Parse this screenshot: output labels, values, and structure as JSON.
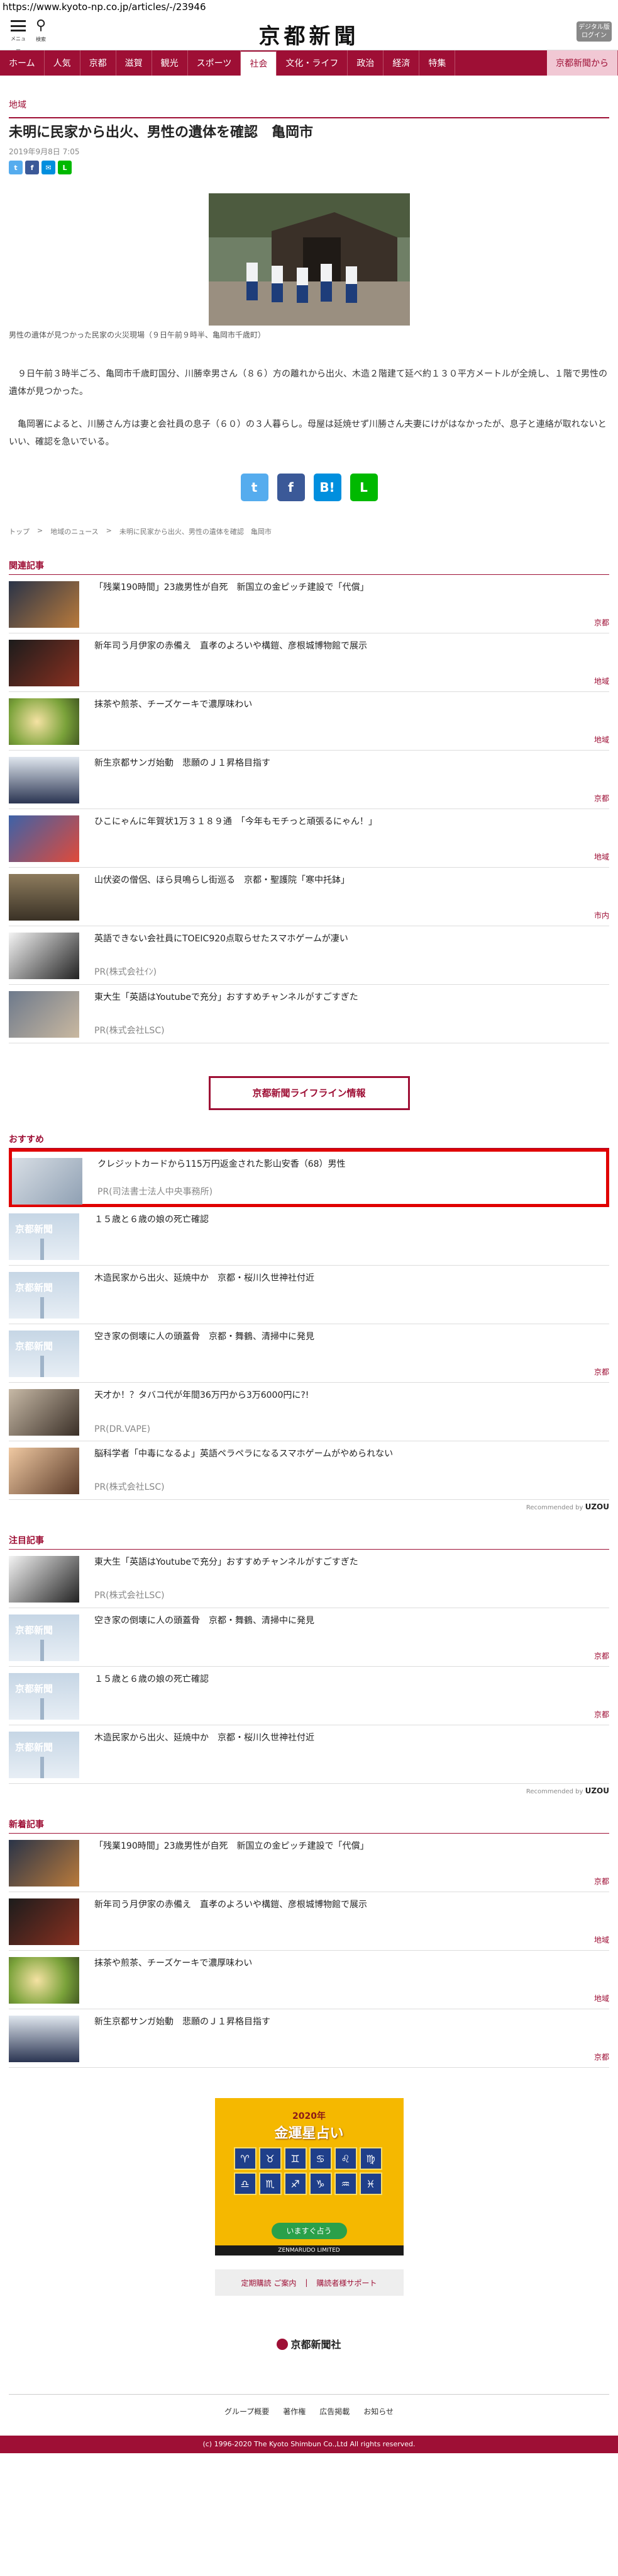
{
  "browser": {
    "url": "https://www.kyoto-np.co.jp/articles/-/23946"
  },
  "header": {
    "logo": "京都新聞",
    "menu_label": "メニュー",
    "search_label": "検索",
    "digital_label_1": "デジタル版",
    "digital_label_2": "ログイン"
  },
  "nav": [
    "ホーム",
    "人気",
    "京都",
    "滋賀",
    "観光",
    "スポーツ",
    "社会",
    "文化・ライフ",
    "政治",
    "経済",
    "特集",
    "京都新聞から"
  ],
  "article": {
    "category": "地域",
    "title": "未明に民家から出火、男性の遺体を確認　亀岡市",
    "date": "2019年9月8日 7:05",
    "caption": "男性の遺体が見つかった民家の火災現場（９日午前９時半、亀岡市千歳町）",
    "paragraphs": [
      "９日午前３時半ごろ、亀岡市千歳町国分、川勝幸男さん（８６）方の離れから出火、木造２階建て延べ約１３０平方メートルが全焼し、１階で男性の遺体が見つかった。",
      "亀岡署によると、川勝さん方は妻と会社員の息子（６０）の３人暮らし。母屋は延焼せず川勝さん夫妻にけがはなかったが、息子と連絡が取れないといい、確認を急いでいる。"
    ]
  },
  "share_icons": {
    "twitter": "twitter-icon",
    "facebook": "facebook-icon",
    "hatena": "hatena-icon",
    "line": "line-icon"
  },
  "breadcrumb": [
    "トップ",
    "地域のニュース",
    "未明に民家から出火、男性の遺体を確認　亀岡市"
  ],
  "related": {
    "heading": "関連記事",
    "items": [
      {
        "title": "「残業190時間」23歳男性が自死　新国立の金ピッチ建設で「代償」",
        "tag": "京都"
      },
      {
        "title": "新年司う月伊家の赤備え　直孝のよろいや構鎧、彦根城博物館で展示",
        "tag": "地域"
      },
      {
        "title": "抹茶や煎茶、チーズケーキで濃厚味わい",
        "tag": "地域"
      },
      {
        "title": "新生京都サンガ始動　悲願のＪ１昇格目指す",
        "tag": "京都"
      },
      {
        "title": "ひこにゃんに年賀状1万３１８９通　「今年もモチっと頑張るにゃん！」",
        "tag": "地域"
      },
      {
        "title": "山伏姿の僧侶、ほら貝鳴らし街巡る　京都・聖護院「寒中托鉢」",
        "tag": "市内"
      }
    ],
    "pr_items": [
      {
        "title": "英語できない会社員にTOEIC920点取らせたスマホゲームが凄い",
        "pr": "PR(株式会社ｲﾝ)"
      },
      {
        "title": "東大生「英語はYoutubeで充分」おすすめチャンネルがすごすぎた",
        "pr": "PR(株式会社LSC)"
      }
    ]
  },
  "lifeline": {
    "label": "京都新聞ライフライン情報"
  },
  "recommend": {
    "heading": "おすすめ",
    "highlight": {
      "title": "クレジットカードから115万円返金された影山安香（68）男性",
      "pr": "PR(司法書士法人中央事務所)"
    },
    "items": [
      {
        "title": "１５歳と６歳の娘の死亡確認",
        "tag": ""
      },
      {
        "title": "木造民家から出火、延焼中か　京都・桜川久世神社付近",
        "tag": ""
      },
      {
        "title": "空き家の倒壊に人の頭蓋骨　京都・舞鶴、清掃中に発見",
        "tag": "京都"
      }
    ],
    "pr_items": [
      {
        "title": "天才か！？タバコ代が年間36万円から3万6000円に?!",
        "pr": "PR(DR.VAPE)"
      },
      {
        "title": "脳科学者「中毒になるよ」英語ペラペラになるスマホゲームがやめられない",
        "pr": "PR(株式会社LSC)"
      }
    ],
    "credit_prefix": "Recommended by",
    "credit_brand": "UZOU"
  },
  "featured": {
    "heading": "注目記事",
    "items": [
      {
        "title": "東大生「英語はYoutubeで充分」おすすめチャンネルがすごすぎた",
        "pr": "PR(株式会社LSC)",
        "tag": ""
      },
      {
        "title": "空き家の倒壊に人の頭蓋骨　京都・舞鶴、清掃中に発見",
        "pr": "",
        "tag": "京都"
      },
      {
        "title": "１５歳と６歳の娘の死亡確認",
        "pr": "",
        "tag": "京都"
      },
      {
        "title": "木造民家から出火、延焼中か　京都・桜川久世神社付近",
        "pr": "",
        "tag": ""
      }
    ],
    "credit_prefix": "Recommended by",
    "credit_brand": "UZOU"
  },
  "latest": {
    "heading": "新着記事",
    "items": [
      {
        "title": "「残業190時間」23歳男性が自死　新国立の金ピッチ建設で「代償」",
        "tag": "京都"
      },
      {
        "title": "新年司う月伊家の赤備え　直孝のよろいや構鎧、彦根城博物館で展示",
        "tag": "地域"
      },
      {
        "title": "抹茶や煎茶、チーズケーキで濃厚味わい",
        "tag": "地域"
      },
      {
        "title": "新生京都サンガ始動　悲願のＪ１昇格目指す",
        "tag": "京都"
      }
    ]
  },
  "ad": {
    "top": "2020年",
    "title": "金運星占い",
    "button": "いますぐ占う",
    "footer": "ZENMARUDO LIMITED"
  },
  "sub_links": [
    "定期購読 ご案内",
    "購読者様サポート"
  ],
  "footer": {
    "logo": "京都新聞社",
    "links": [
      "グループ概要",
      "著作権",
      "広告掲載",
      "お知らせ"
    ],
    "copyright": "(c) 1996-2020 The Kyoto Shimbun Co.,Ltd All rights reserved."
  }
}
